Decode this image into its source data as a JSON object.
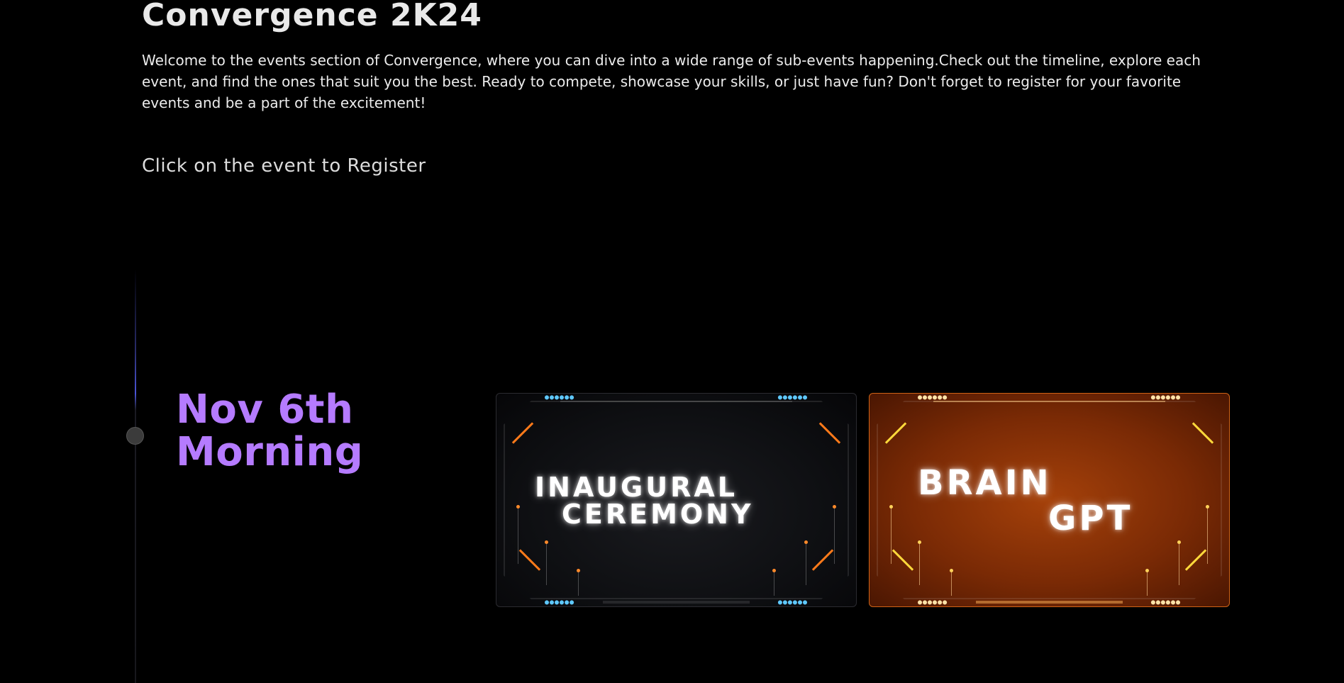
{
  "page": {
    "title": "Convergence 2K24",
    "intro": "Welcome to the events section of Convergence, where you can dive into a wide range of sub-events happening.Check out the timeline, explore each event, and find the ones that suit you the best. Ready to compete, showcase your skills, or just have fun? Don't forget to register for your favorite events and be a part of the excitement!",
    "hint": "Click on the event to Register"
  },
  "timeline": {
    "date_line_1": "Nov 6th",
    "date_line_2": "Morning",
    "accent_color": "#b57bff"
  },
  "events": [
    {
      "line_1": "INAUGURAL",
      "line_2": "CEREMONY",
      "theme": "dark"
    },
    {
      "line_1": "BRAIN",
      "line_2": "GPT",
      "theme": "orange"
    }
  ],
  "colors": {
    "background": "#000000",
    "text": "#e6e6e6",
    "card_orange": "#a5410a"
  }
}
